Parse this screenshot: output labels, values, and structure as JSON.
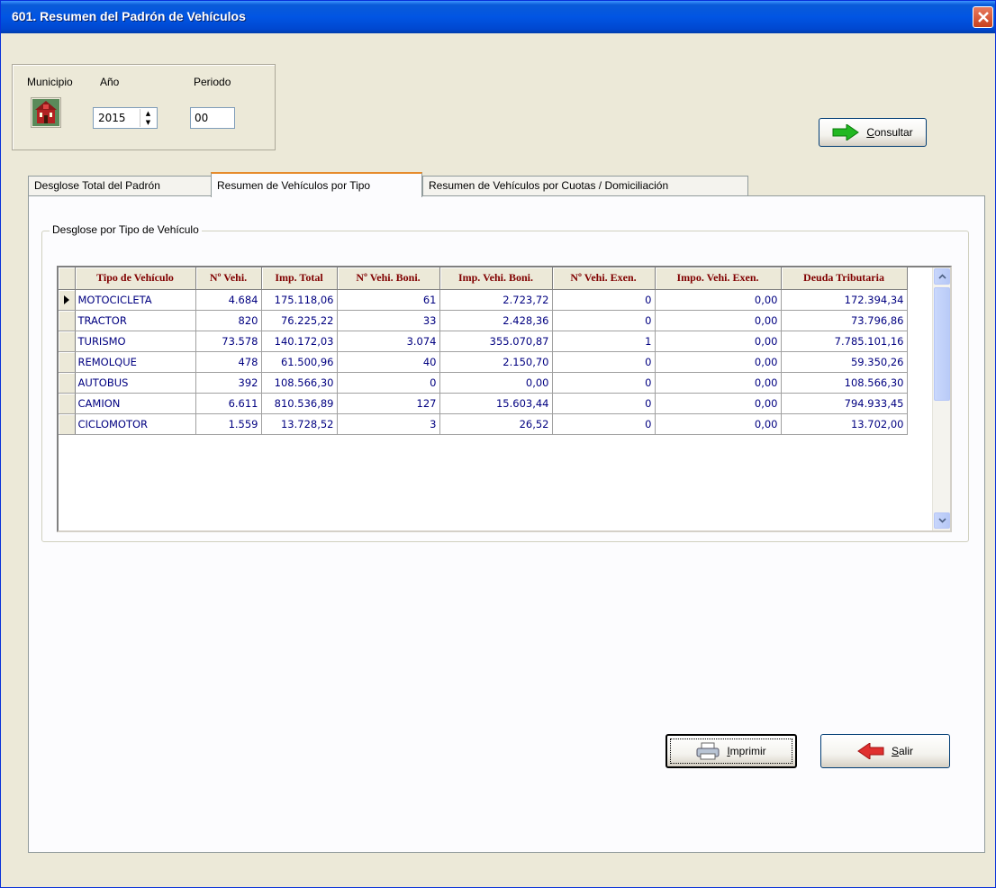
{
  "window": {
    "title": "601. Resumen del Padrón de Vehículos"
  },
  "params": {
    "municipio_label": "Municipio",
    "anio_label": "Año",
    "anio_value": "2015",
    "periodo_label": "Periodo",
    "periodo_value": "00"
  },
  "buttons": {
    "consultar": "Consultar",
    "imprimir": "Imprimir",
    "salir": "Salir"
  },
  "tabs": [
    {
      "label": "Desglose Total del Padrón",
      "active": false
    },
    {
      "label": "Resumen de Vehículos por Tipo",
      "active": true
    },
    {
      "label": "Resumen de Vehículos por Cuotas / Domiciliación",
      "active": false
    }
  ],
  "group": {
    "legend": "Desglose por Tipo de Vehículo"
  },
  "grid": {
    "columns": [
      "Tipo de Vehículo",
      "Nº Vehi.",
      "Imp. Total",
      "Nº Vehi. Boni.",
      "Imp. Vehi. Boni.",
      "Nº Vehi. Exen.",
      "Impo. Vehi. Exen.",
      "Deuda Tributaria"
    ],
    "rows": [
      [
        "MOTOCICLETA",
        "4.684",
        "175.118,06",
        "61",
        "2.723,72",
        "0",
        "0,00",
        "172.394,34"
      ],
      [
        "TRACTOR",
        "820",
        "76.225,22",
        "33",
        "2.428,36",
        "0",
        "0,00",
        "73.796,86"
      ],
      [
        "TURISMO",
        "73.578",
        "140.172,03",
        "3.074",
        "355.070,87",
        "1",
        "0,00",
        "7.785.101,16"
      ],
      [
        "REMOLQUE",
        "478",
        "61.500,96",
        "40",
        "2.150,70",
        "0",
        "0,00",
        "59.350,26"
      ],
      [
        "AUTOBUS",
        "392",
        "108.566,30",
        "0",
        "0,00",
        "0",
        "0,00",
        "108.566,30"
      ],
      [
        "CAMION",
        "6.611",
        "810.536,89",
        "127",
        "15.603,44",
        "0",
        "0,00",
        "794.933,45"
      ],
      [
        "CICLOMOTOR",
        "1.559",
        "13.728,52",
        "3",
        "26,52",
        "0",
        "0,00",
        "13.702,00"
      ]
    ],
    "selected_row": 0
  },
  "icons": {
    "municipio": "town-hall-icon",
    "consultar": "green-arrow-right-icon",
    "imprimir": "printer-icon",
    "salir": "red-arrow-left-icon",
    "close": "close-icon"
  }
}
